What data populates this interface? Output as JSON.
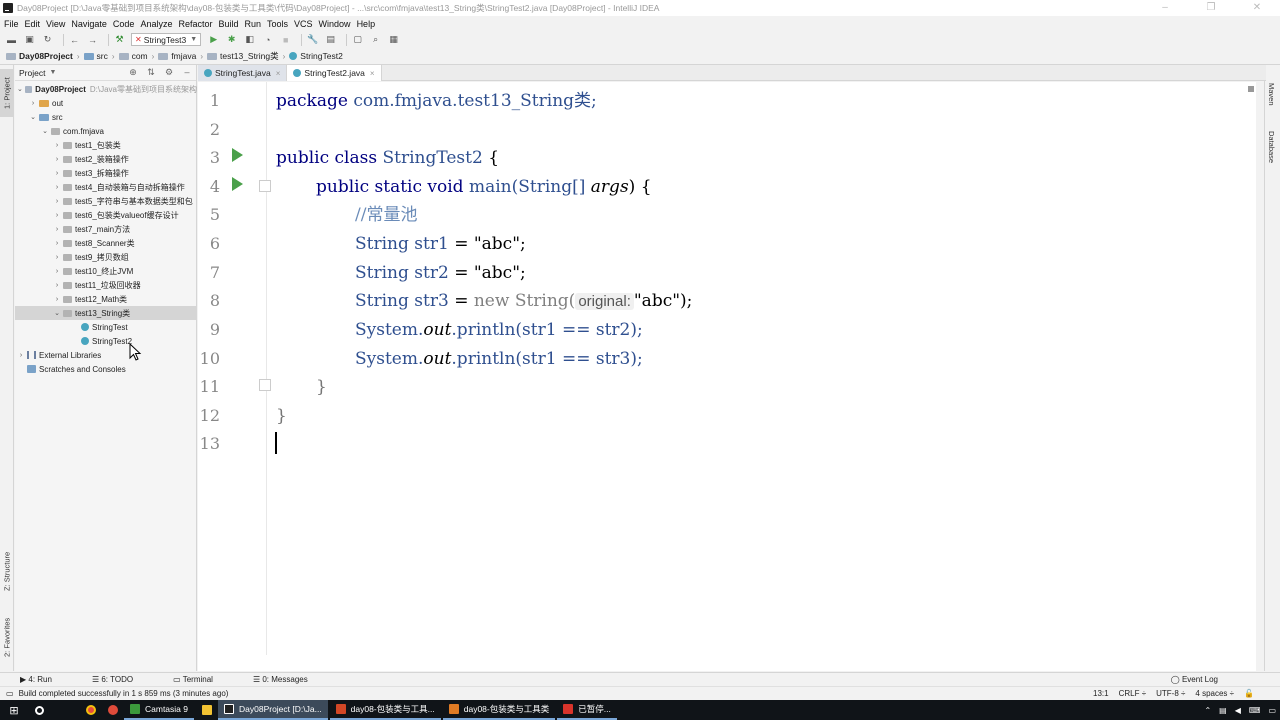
{
  "window": {
    "title": "Day08Project [D:\\Java零基础到项目系统架构\\day08-包装类与工具类\\代码\\Day08Project] - ...\\src\\com\\fmjava\\test13_String类\\StringTest2.java [Day08Project] - IntelliJ IDEA"
  },
  "menu": [
    "File",
    "Edit",
    "View",
    "Navigate",
    "Code",
    "Analyze",
    "Refactor",
    "Build",
    "Run",
    "Tools",
    "VCS",
    "Window",
    "Help"
  ],
  "toolbar": {
    "run_config": "StringTest3"
  },
  "breadcrumb": [
    "Day08Project",
    "src",
    "com",
    "fmjava",
    "test13_String类",
    "StringTest2"
  ],
  "left_strip": {
    "project": "1: Project",
    "structure": "Z: Structure",
    "favorites": "2: Favorites"
  },
  "right_strip": {
    "maven": "Maven",
    "database": "Database"
  },
  "project_panel": {
    "title": "Project",
    "root": "Day08Project",
    "root_path": "D:\\Java零基础到项目系统架构",
    "nodes": [
      "out",
      "src",
      "com.fmjava",
      "test1_包装类",
      "test2_装箱操作",
      "test3_拆箱操作",
      "test4_自动装箱与自动拆箱操作",
      "test5_字符串与基本数据类型和包",
      "test6_包装类valueof缓存设计",
      "test7_main方法",
      "test8_Scanner类",
      "test9_拷贝数组",
      "test10_终止JVM",
      "test11_垃圾回收器",
      "test12_Math类",
      "test13_String类",
      "StringTest",
      "StringTest2",
      "External Libraries",
      "Scratches and Consoles"
    ]
  },
  "editor_tabs": [
    {
      "label": "StringTest.java",
      "close": "×"
    },
    {
      "label": "StringTest2.java",
      "close": "×"
    }
  ],
  "code": {
    "line_numbers": [
      "1",
      "2",
      "3",
      "4",
      "5",
      "6",
      "7",
      "8",
      "9",
      "10",
      "11",
      "12",
      "13"
    ],
    "l1_kw": "package",
    "l1_rest": "com.fmjava.test13_String类;",
    "l3_kw": "public class",
    "l3_name": "StringTest2",
    "l3_brace": "{",
    "l4_kw": "public static void",
    "l4_name": "main(",
    "l4_type": "String[]",
    "l4_arg": "args",
    "l4_end": ") {",
    "l5_comment": "//常量池",
    "l6_type": "String",
    "l6_var": "str1",
    "l6_op": "=",
    "l6_str": "\"abc\"",
    "l6_end": ";",
    "l7_type": "String",
    "l7_var": "str2",
    "l7_op": "=",
    "l7_str": "\"abc\"",
    "l7_end": ";",
    "l8_type": "String",
    "l8_var": "str3",
    "l8_op": "=",
    "l8_new": "new",
    "l8_call": "String(",
    "l8_hint": "original:",
    "l8_str": "\"abc\"",
    "l8_end": ");",
    "l9_sys": "System.",
    "l9_out": "out",
    "l9_call": ".println(str1 == str2);",
    "l10_sys": "System.",
    "l10_out": "out",
    "l10_call": ".println(str1 == str3);",
    "l11": "}",
    "l12": "}"
  },
  "bottom_tabs": {
    "run": "4: Run",
    "todo": "6: TODO",
    "terminal": "Terminal",
    "messages": "0: Messages",
    "event_log": "Event Log"
  },
  "status": {
    "message": "Build completed successfully in 1 s 859 ms (3 minutes ago)",
    "position": "13:1",
    "line_sep": "CRLF ÷",
    "encoding": "UTF-8 ÷",
    "indent": "4 spaces ÷"
  },
  "taskbar": {
    "items": [
      "Camtasia 9",
      "Day08Project [D:\\Ja...",
      "day08-包装类与工具...",
      "day08-包装类与工具类",
      "已暂停..."
    ]
  }
}
